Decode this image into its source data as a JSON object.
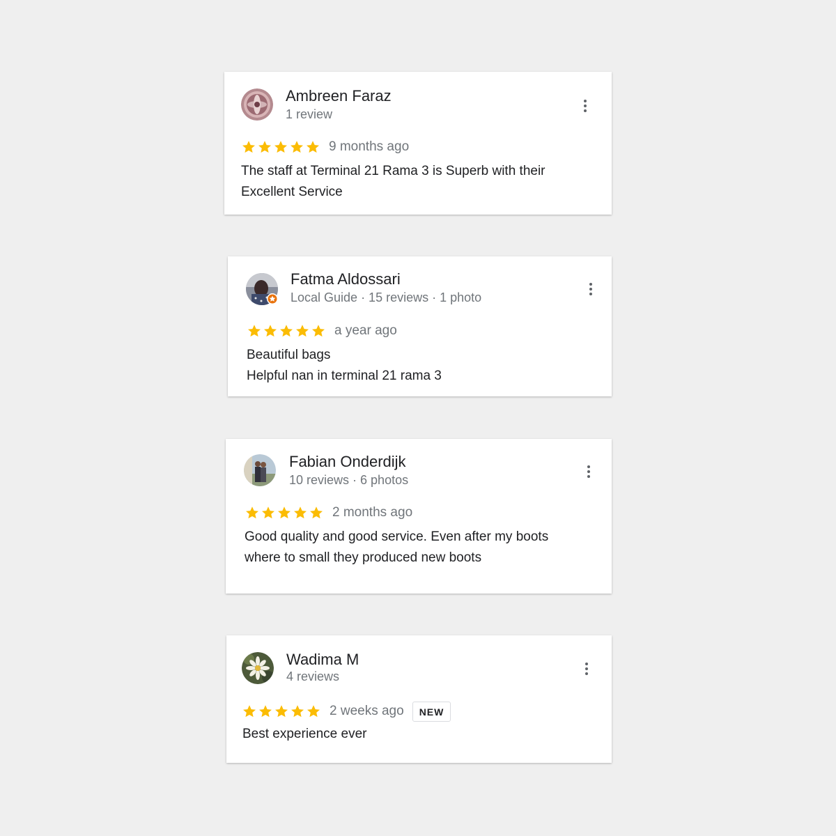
{
  "reviews": [
    {
      "name": "Ambreen Faraz",
      "meta": "1 review",
      "rating": 5,
      "time": "9 months ago",
      "badge": "",
      "lines": [
        "The staff at Terminal 21 Rama 3 is Superb with their",
        "Excellent Service"
      ],
      "avatar_icon": "ornate-pattern-avatar"
    },
    {
      "name": "Fatma Aldossari",
      "meta": "Local Guide · 15 reviews · 1 photo",
      "rating": 5,
      "time": "a year ago",
      "badge": "",
      "lines": [
        "Beautiful bags",
        "Helpful nan in terminal 21 rama 3"
      ],
      "avatar_icon": "photo-avatar-with-local-guide-badge"
    },
    {
      "name": "Fabian Onderdijk",
      "meta": "10 reviews · 6 photos",
      "rating": 5,
      "time": "2 months ago",
      "badge": "",
      "lines": [
        "Good quality and good service. Even after my boots",
        "where to small they produced new boots"
      ],
      "avatar_icon": "couple-photo-avatar"
    },
    {
      "name": "Wadima M",
      "meta": "4 reviews",
      "rating": 5,
      "time": "2 weeks ago",
      "badge": "NEW",
      "lines": [
        "Best experience ever"
      ],
      "avatar_icon": "flower-photo-avatar"
    }
  ],
  "colors": {
    "star": "#fbbc04",
    "background": "#efefef",
    "secondary_text": "#70757a",
    "local_guide_badge": "#e8710a"
  }
}
